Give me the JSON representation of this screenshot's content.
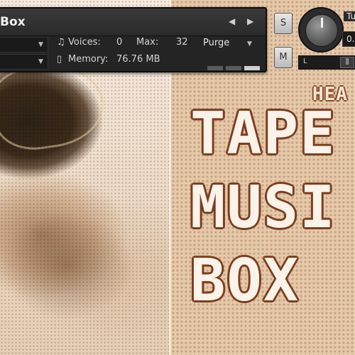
{
  "header": {
    "instrument_name": "Box",
    "voices_label": "Voices:",
    "voices_value": "0",
    "max_label": "Max:",
    "max_value": "32",
    "purge_label": "Purge",
    "memory_label": "Memory:",
    "memory_value": "76.76 MB"
  },
  "controls": {
    "solo_label": "S",
    "mute_label": "M",
    "tune_label": "Tu",
    "tune_value": "0.",
    "pan_left_label": "L"
  },
  "artwork": {
    "brand_fragment": "HEA",
    "title_lines": [
      "TAPE",
      "MUSI",
      "BOX"
    ]
  },
  "colors": {
    "panel": "#242424",
    "title_outline": "#7b3e1e",
    "background": "#e4c9aa"
  }
}
